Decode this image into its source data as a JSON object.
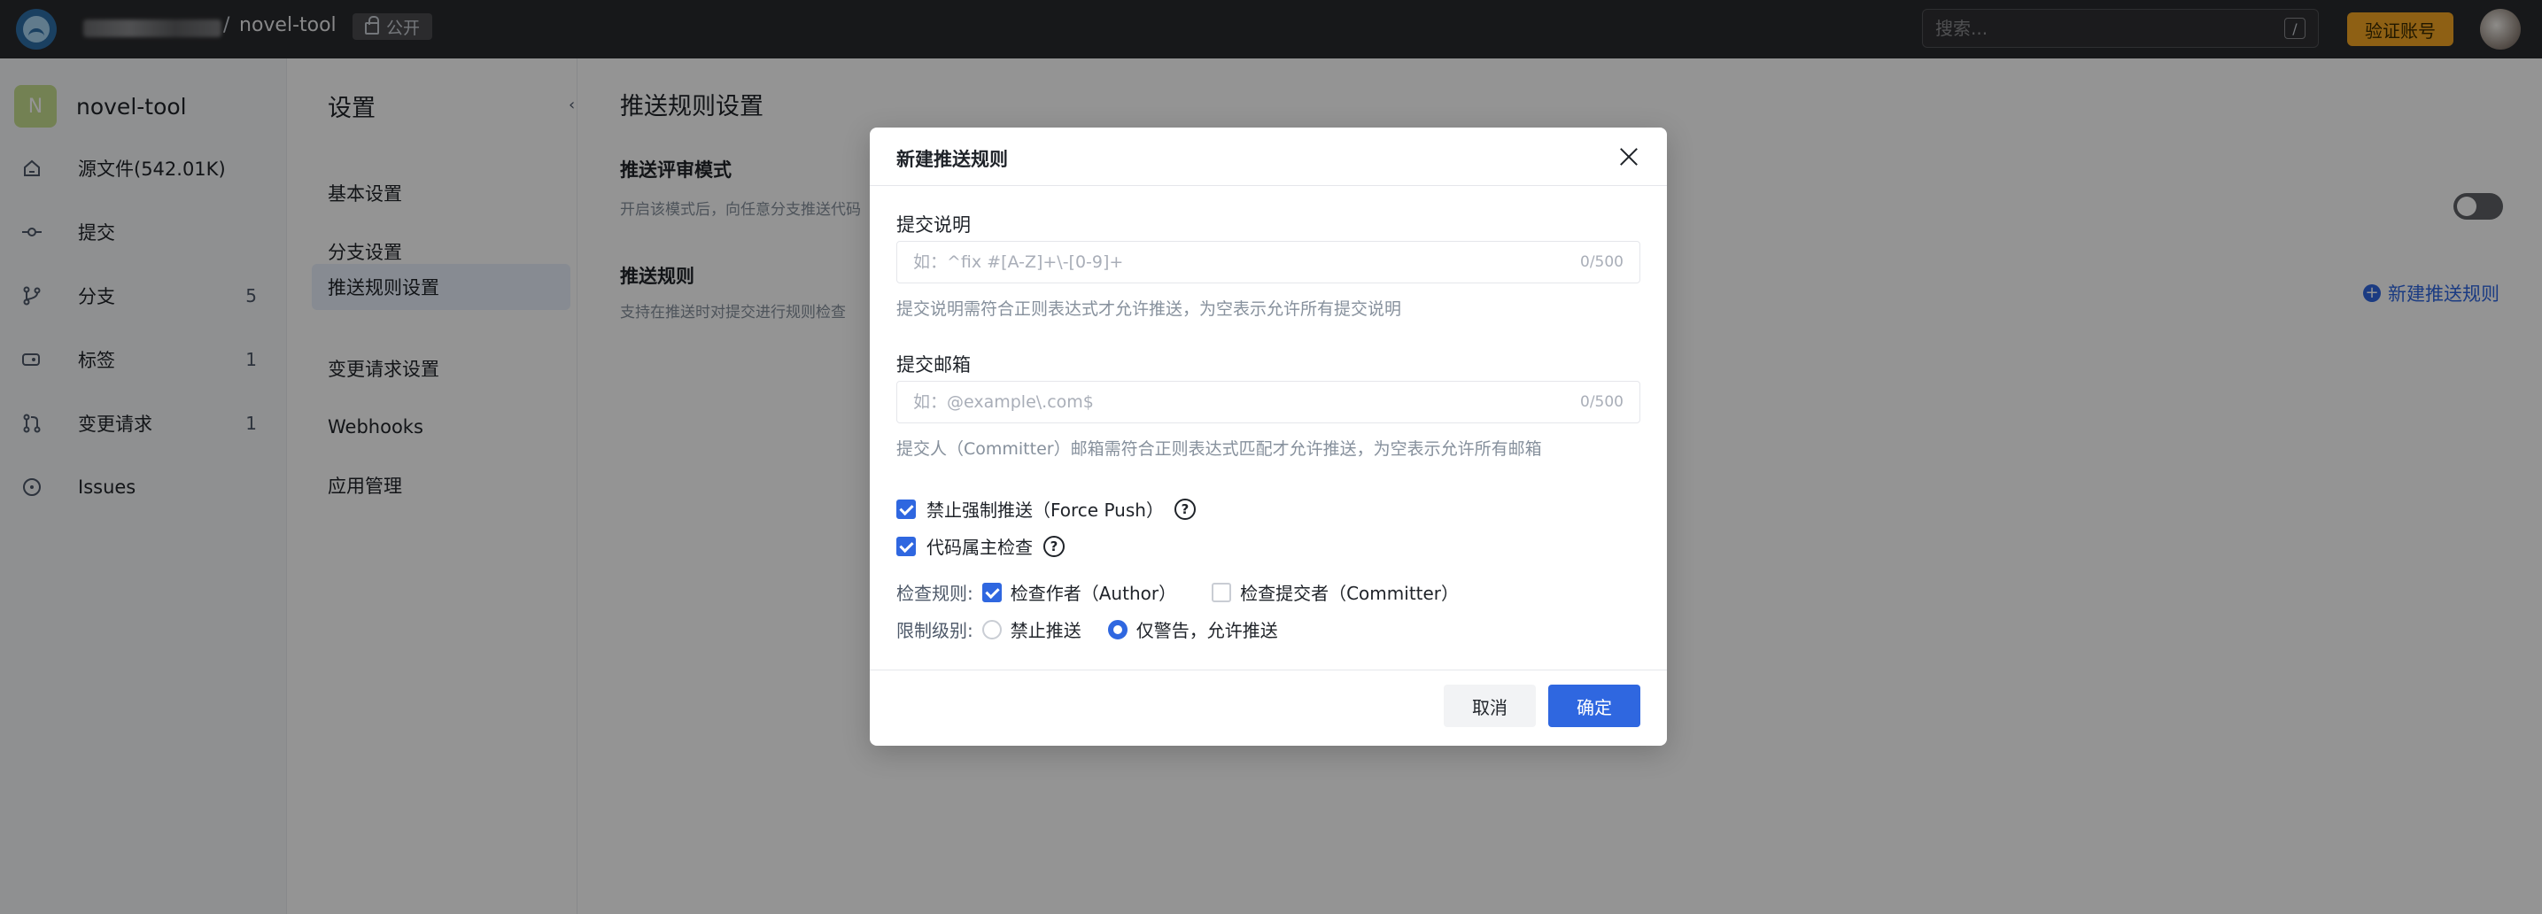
{
  "header": {
    "repo_name": "novel-tool",
    "separator": "/",
    "visibility": "公开",
    "search_placeholder": "搜索...",
    "search_shortcut": "/",
    "verify_button": "验证账号"
  },
  "sidebar": {
    "repo_avatar_letter": "N",
    "repo_title": "novel-tool",
    "items": [
      {
        "label": "源文件(542.01K)",
        "count": "",
        "icon": "home-icon"
      },
      {
        "label": "提交",
        "count": "",
        "icon": "commit-icon"
      },
      {
        "label": "分支",
        "count": "5",
        "icon": "branch-icon"
      },
      {
        "label": "标签",
        "count": "1",
        "icon": "tag-icon"
      },
      {
        "label": "变更请求",
        "count": "1",
        "icon": "merge-request-icon"
      },
      {
        "label": "Issues",
        "count": "",
        "icon": "issue-icon"
      }
    ]
  },
  "settings": {
    "title": "设置",
    "collapse": "‹",
    "items": [
      "基本设置",
      "分支设置",
      "推送规则设置",
      "变更请求设置",
      "Webhooks",
      "应用管理"
    ],
    "active_index": 2
  },
  "main": {
    "title": "推送规则设置",
    "review_mode_title": "推送评审模式",
    "review_mode_desc": "开启该模式后，向任意分支推送代码",
    "push_rules_title": "推送规则",
    "push_rules_desc": "支持在推送时对提交进行规则检查",
    "new_rule_link": "新建推送规则"
  },
  "modal": {
    "title": "新建推送规则",
    "commit_msg_label": "提交说明",
    "commit_msg_placeholder": "如：^fix #[A-Z]+\\-[0-9]+",
    "commit_msg_counter": "0/500",
    "commit_msg_hint": "提交说明需符合正则表达式才允许推送，为空表示允许所有提交说明",
    "commit_email_label": "提交邮箱",
    "commit_email_placeholder": "如：@example\\.com$",
    "commit_email_counter": "0/500",
    "commit_email_hint": "提交人（Committer）邮箱需符合正则表达式匹配才允许推送，为空表示允许所有邮箱",
    "force_push_label": "禁止强制推送（Force Push）",
    "force_push_checked": true,
    "code_owner_label": "代码属主检查",
    "code_owner_checked": true,
    "check_rule_label": "检查规则:",
    "check_author_label": "检查作者（Author）",
    "check_author_checked": true,
    "check_committer_label": "检查提交者（Committer）",
    "check_committer_checked": false,
    "limit_level_label": "限制级别:",
    "forbid_push_label": "禁止推送",
    "warn_only_label": "仅警告，允许推送",
    "selected_level": "warn_only",
    "cancel_button": "取消",
    "confirm_button": "确定"
  },
  "colors": {
    "primary": "#2f67e0",
    "topbar": "#292a2d",
    "verify": "#f5a623"
  }
}
